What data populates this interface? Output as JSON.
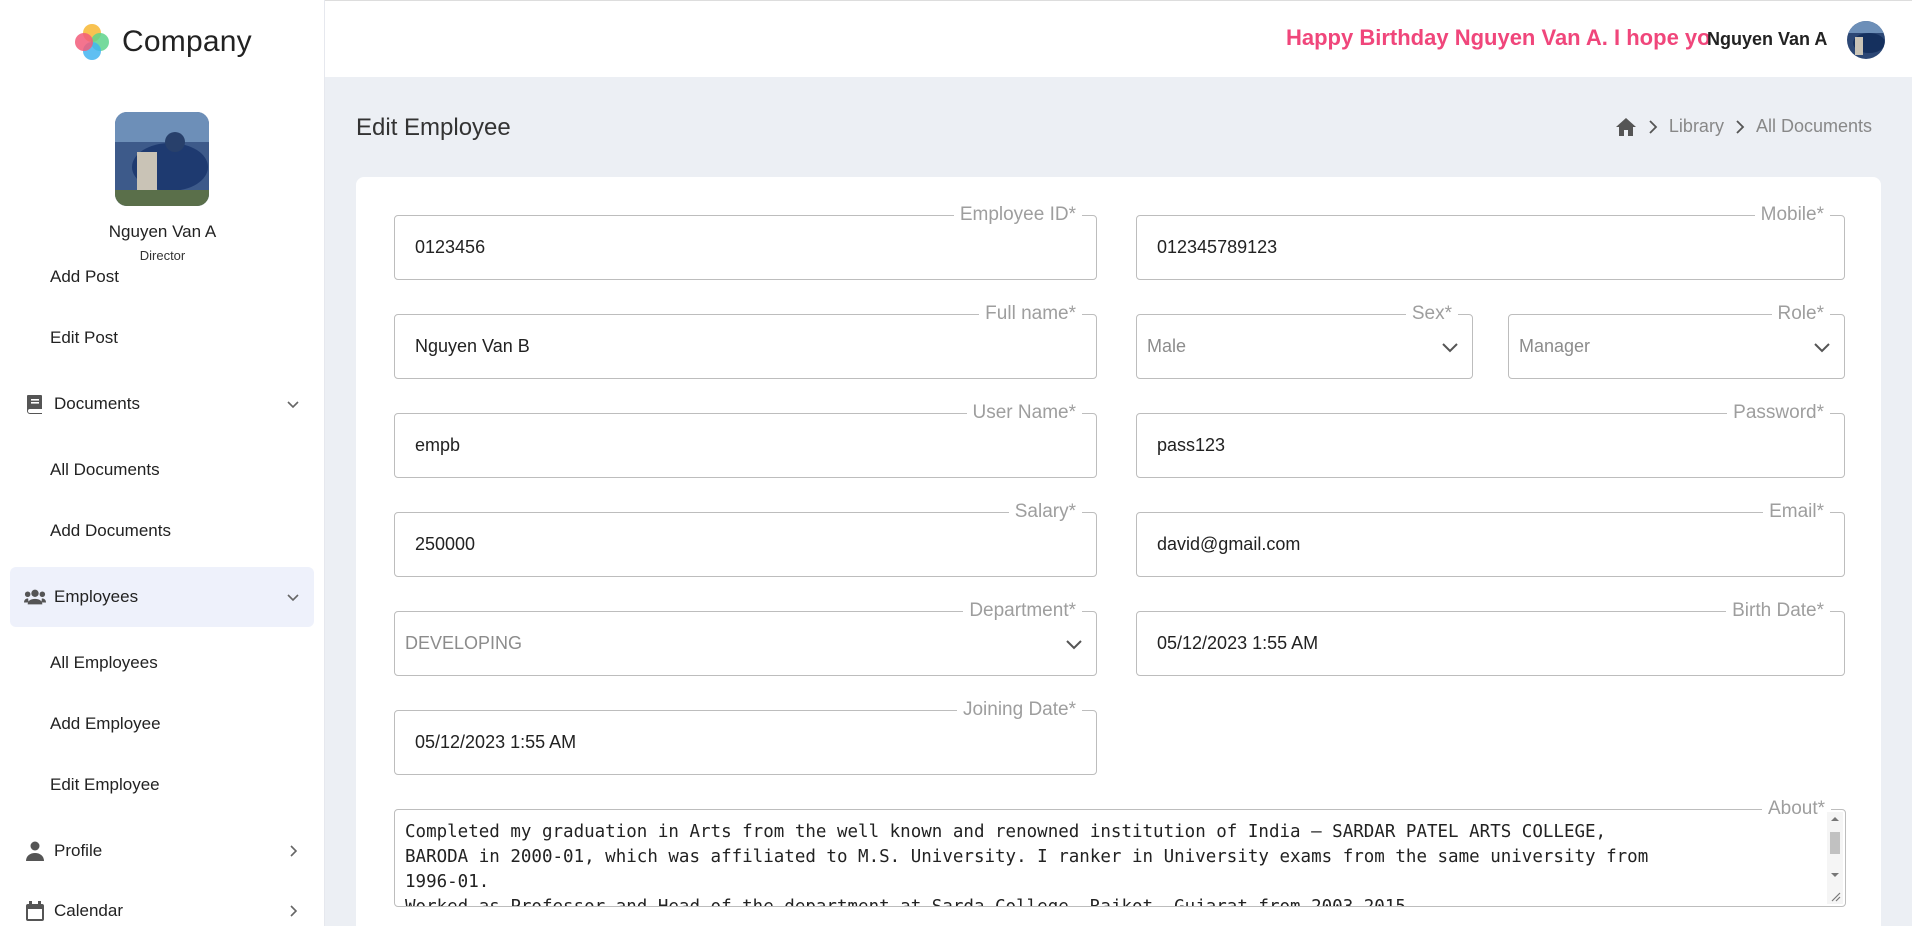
{
  "brand": {
    "name": "Company"
  },
  "profile": {
    "name": "Nguyen Van A",
    "role": "Director"
  },
  "sidebar": {
    "items": [
      {
        "label": "Add Post",
        "type": "sub"
      },
      {
        "label": "Edit Post",
        "type": "sub"
      },
      {
        "label": "Documents",
        "type": "group",
        "icon": "book-icon",
        "chevron": "down"
      },
      {
        "label": "All Documents",
        "type": "sub"
      },
      {
        "label": "Add Documents",
        "type": "sub"
      },
      {
        "label": "Employees",
        "type": "group",
        "icon": "users-icon",
        "chevron": "down",
        "active": true
      },
      {
        "label": "All Employees",
        "type": "sub"
      },
      {
        "label": "Add Employee",
        "type": "sub"
      },
      {
        "label": "Edit Employee",
        "type": "sub"
      },
      {
        "label": "Profile",
        "type": "group",
        "icon": "user-icon",
        "chevron": "right"
      },
      {
        "label": "Calendar",
        "type": "group",
        "icon": "calendar-icon",
        "chevron": "right"
      }
    ]
  },
  "topbar": {
    "ticker": "Happy Birthday Nguyen Van A. I hope yo",
    "user_name": "Nguyen Van A"
  },
  "page": {
    "title": "Edit Employee",
    "breadcrumb": [
      "Library",
      "All Documents"
    ]
  },
  "form": {
    "employee_id": {
      "label": "Employee ID*",
      "value": "0123456"
    },
    "mobile": {
      "label": "Mobile*",
      "value": "012345789123"
    },
    "full_name": {
      "label": "Full name*",
      "value": "Nguyen Van B"
    },
    "sex": {
      "label": "Sex*",
      "value": "Male"
    },
    "role": {
      "label": "Role*",
      "value": "Manager"
    },
    "user_name": {
      "label": "User Name*",
      "value": "empb"
    },
    "password": {
      "label": "Password*",
      "value": "pass123"
    },
    "salary": {
      "label": "Salary*",
      "value": "250000"
    },
    "email": {
      "label": "Email*",
      "value": "david@gmail.com"
    },
    "department": {
      "label": "Department*",
      "value": "DEVELOPING"
    },
    "birth_date": {
      "label": "Birth Date*",
      "value": "05/12/2023 1:55 AM"
    },
    "joining_date": {
      "label": "Joining Date*",
      "value": "05/12/2023 1:55 AM"
    },
    "about": {
      "label": "About*",
      "line1": "Completed my graduation in Arts from the well known and renowned institution of India – SARDAR PATEL ARTS COLLEGE,",
      "line2": "BARODA in 2000-01, which was affiliated to M.S. University. I ranker in University exams from the same university from",
      "line3": "1996-01.",
      "line4": "Worked as Professor and Head of the department at Sarda College, Rajkot, Gujarat from 2003-2015"
    }
  },
  "colors": {
    "accent": "#f0467b",
    "active_bg": "#eef1fb",
    "page_bg": "#eceff4"
  }
}
